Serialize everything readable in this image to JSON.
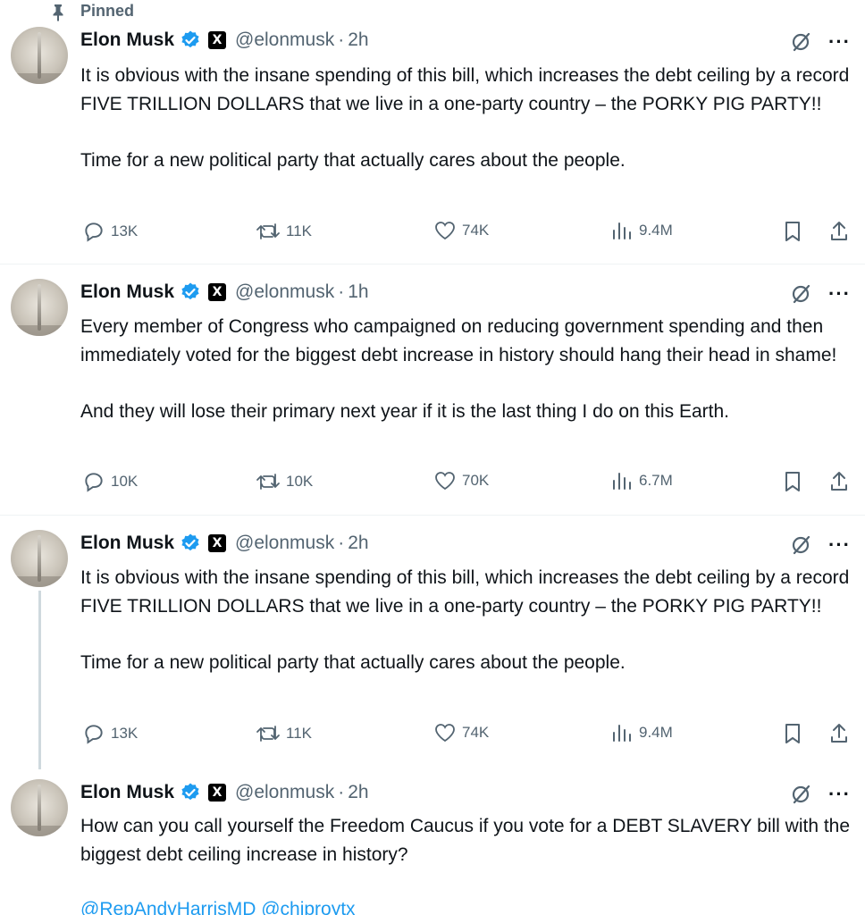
{
  "pinned_label": "Pinned",
  "colors": {
    "text": "#0f1419",
    "muted": "#536471",
    "verified": "#1d9bf0",
    "link": "#1d9bf0"
  },
  "icons": [
    "pin-icon",
    "verified-badge-icon",
    "x-logo-icon",
    "grok-icon",
    "more-icon",
    "reply-icon",
    "retweet-icon",
    "like-icon",
    "views-icon",
    "bookmark-icon",
    "share-icon"
  ],
  "tweets": [
    {
      "name": "Elon Musk",
      "x_badge": "X",
      "handle": "@elonmusk",
      "separator": "·",
      "time": "2h",
      "text": "It is obvious with the insane spending of this bill, which increases the debt ceiling by a record FIVE TRILLION DOLLARS that we live in a one-party country – the PORKY PIG PARTY!!\n\nTime for a new political party that actually cares about the people.",
      "replies": "13K",
      "retweets": "11K",
      "likes": "74K",
      "views": "9.4M"
    },
    {
      "name": "Elon Musk",
      "x_badge": "X",
      "handle": "@elonmusk",
      "separator": "·",
      "time": "1h",
      "text": "Every member of Congress who campaigned on reducing government spending and then immediately voted for the biggest debt increase in history should hang their head in shame!\n\nAnd they will lose their primary next year if it is the last thing I do on this Earth.",
      "replies": "10K",
      "retweets": "10K",
      "likes": "70K",
      "views": "6.7M"
    },
    {
      "name": "Elon Musk",
      "x_badge": "X",
      "handle": "@elonmusk",
      "separator": "·",
      "time": "2h",
      "text": "It is obvious with the insane spending of this bill, which increases the debt ceiling by a record FIVE TRILLION DOLLARS that we live in a one-party country – the PORKY PIG PARTY!!\n\nTime for a new political party that actually cares about the people.",
      "replies": "13K",
      "retweets": "11K",
      "likes": "74K",
      "views": "9.4M"
    },
    {
      "name": "Elon Musk",
      "x_badge": "X",
      "handle": "@elonmusk",
      "separator": "·",
      "time": "2h",
      "text": "How can you call yourself the Freedom Caucus if you vote for a DEBT SLAVERY bill with the biggest debt ceiling increase in history?",
      "mentions": "@RepAndyHarrisMD @chiproytx"
    }
  ]
}
